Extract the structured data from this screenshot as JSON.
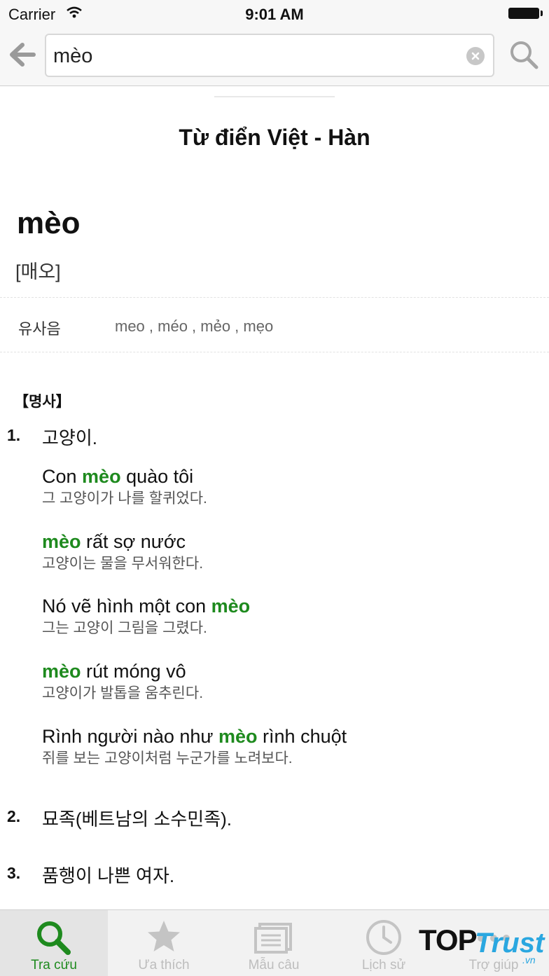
{
  "status_bar": {
    "carrier": "Carrier",
    "time": "9:01 AM"
  },
  "search": {
    "query": "mèo"
  },
  "dictionary_title": "Từ điển Việt - Hàn",
  "entry": {
    "headword": "mèo",
    "pronunciation": "[매오]",
    "similar_label": "유사음",
    "similar_values": "meo , méo , mẻo , mẹo",
    "part_of_speech": "【명사】",
    "senses": [
      {
        "number": "1.",
        "text": "고양이.",
        "examples": [
          {
            "vi_before": "Con ",
            "vi_highlight": "mèo",
            "vi_after": " quào tôi",
            "ko": "그 고양이가 나를 할퀴었다."
          },
          {
            "vi_before": "",
            "vi_highlight": "mèo",
            "vi_after": " rất sợ nước",
            "ko": "고양이는 물을 무서워한다."
          },
          {
            "vi_before": "Nó vẽ hình một con ",
            "vi_highlight": "mèo",
            "vi_after": "",
            "ko": "그는 고양이 그림을 그렸다."
          },
          {
            "vi_before": "",
            "vi_highlight": "mèo",
            "vi_after": " rút móng vô",
            "ko": "고양이가 발톱을 움추린다."
          },
          {
            "vi_before": "Rình người nào như ",
            "vi_highlight": "mèo",
            "vi_after": " rình chuột",
            "ko": "쥐를 보는 고양이처럼 누군가를 노려보다."
          }
        ]
      },
      {
        "number": "2.",
        "text": "묘족(베트남의 소수민족)."
      },
      {
        "number": "3.",
        "text": "품행이 나쁜 여자."
      }
    ]
  },
  "tabs": [
    {
      "label": "Tra cứu",
      "icon": "search-icon",
      "active": true
    },
    {
      "label": "Ưa thích",
      "icon": "star-icon",
      "active": false
    },
    {
      "label": "Mẫu câu",
      "icon": "document-icon",
      "active": false
    },
    {
      "label": "Lịch sử",
      "icon": "clock-icon",
      "active": false
    },
    {
      "label": "Trợ giúp",
      "icon": "more-icon",
      "active": false
    }
  ],
  "watermark": {
    "top": "TOP",
    "trust": "Trust",
    "vn": ".vn"
  },
  "colors": {
    "highlight": "#1e8a1e",
    "tab_inactive": "#bdbdbd",
    "watermark_blue": "#2aa7e0"
  }
}
